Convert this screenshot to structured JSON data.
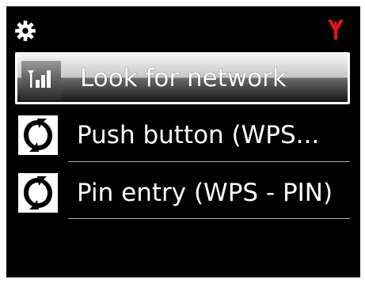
{
  "status_bar": {
    "settings_icon": "gear-icon",
    "network_icon": "antenna-icon",
    "network_icon_color": "#e8141c"
  },
  "menu": {
    "items": [
      {
        "label": "Look for network",
        "icon": "signal-bars-icon",
        "selected": true
      },
      {
        "label": "Push button (WPS...",
        "icon": "wps-icon",
        "selected": false
      },
      {
        "label": "Pin entry (WPS - PIN)",
        "icon": "wps-icon",
        "selected": false
      }
    ]
  },
  "colors": {
    "background": "#000000",
    "frame": "#ffffff",
    "text": "#ffffff",
    "accent_red": "#e8141c"
  }
}
